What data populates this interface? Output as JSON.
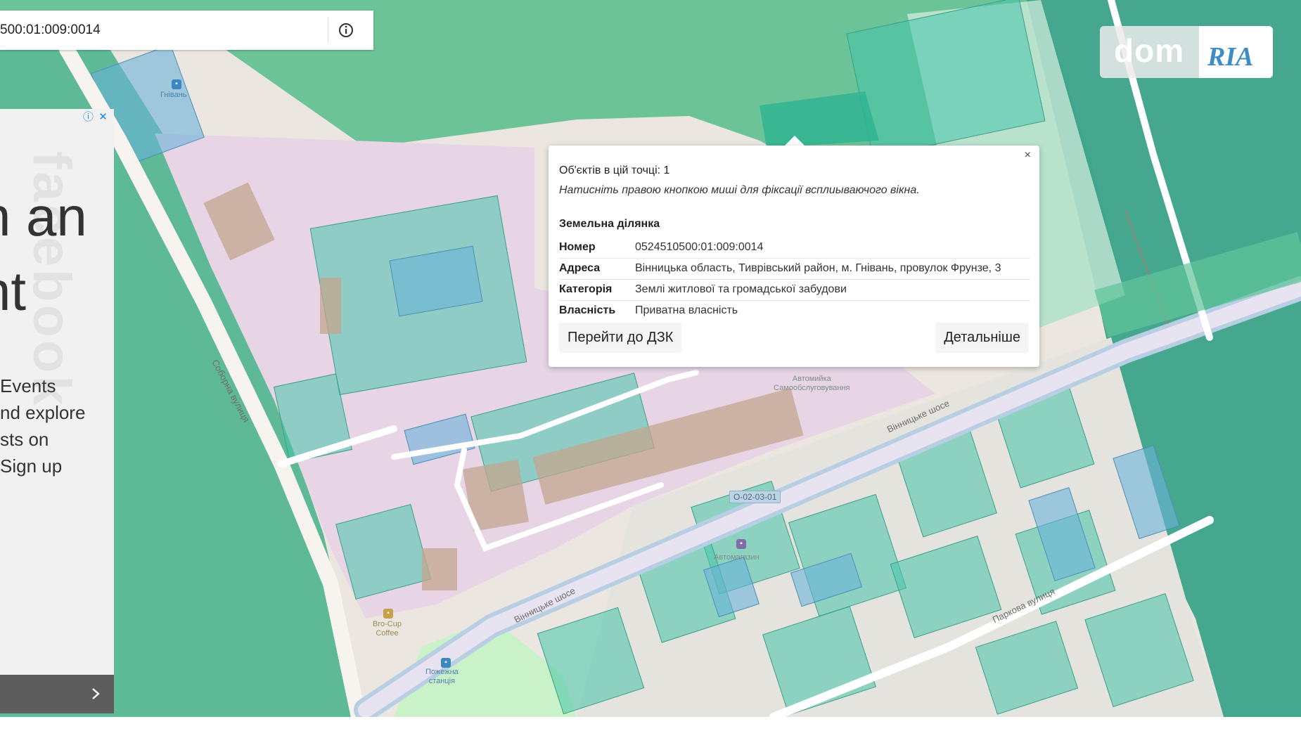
{
  "search": {
    "value": "500:01:009:0014"
  },
  "map": {
    "labels": {
      "soborna": "Соборна вулиця",
      "vinnytske1": "Вінницьке шосе",
      "vinnytske2": "Вінницьке шосе",
      "parkova": "Паркова вулиця",
      "road_code": "О-02-03-01",
      "carwash_1": "Автомийка",
      "carwash_2": "Самообслуговування",
      "hnivan": "Гнівань",
      "shop": "Автомагазин",
      "cafe_1": "Bro-Cup",
      "cafe_2": "Coffee",
      "station_1": "Пожежна",
      "station_2": "станція"
    }
  },
  "ad": {
    "watermark": "facebook",
    "headline_1": "n an",
    "headline_2": "nt",
    "body": [
      "Events",
      "nd explore",
      "sts on",
      "Sign up"
    ]
  },
  "brand": {
    "left": "dom",
    "right": "RIA"
  },
  "popup": {
    "close": "×",
    "count": "Об'єктів в цій точці: 1",
    "hint": "Натисніть правою кнопкою миші для фіксації всплиываючого вікна.",
    "section_title": "Земельна ділянка",
    "rows": [
      {
        "label": "Номер",
        "value": "0524510500:01:009:0014"
      },
      {
        "label": "Адреса",
        "value": "Вінницька область, Тиврівський район, м. Гнівань, провулок Фрунзе, 3"
      },
      {
        "label": "Категорія",
        "value": "Землі житлової та громадської забудови"
      },
      {
        "label": "Власність",
        "value": "Приватна власність"
      }
    ],
    "btn_dzk": "Перейти до ДЗК",
    "btn_details": "Детальніше"
  }
}
